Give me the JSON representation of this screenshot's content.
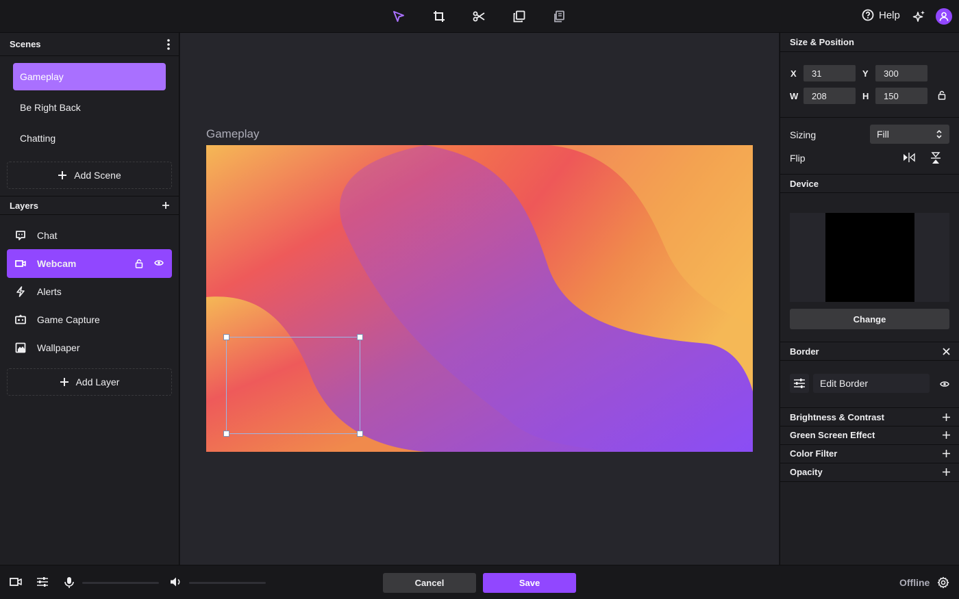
{
  "toolbar": {
    "tools": [
      "select-icon",
      "crop-icon",
      "scissors-icon",
      "duplicate-icon",
      "layers-stack-icon"
    ],
    "help_label": "Help"
  },
  "scenes": {
    "title": "Scenes",
    "items": [
      {
        "label": "Gameplay",
        "active": true
      },
      {
        "label": "Be Right Back",
        "active": false
      },
      {
        "label": "Chatting",
        "active": false
      }
    ],
    "add_label": "Add Scene"
  },
  "layers": {
    "title": "Layers",
    "items": [
      {
        "label": "Chat",
        "icon": "chat-icon",
        "active": false
      },
      {
        "label": "Webcam",
        "icon": "camera-icon",
        "active": true
      },
      {
        "label": "Alerts",
        "icon": "alert-icon",
        "active": false
      },
      {
        "label": "Game Capture",
        "icon": "gamepad-icon",
        "active": false
      },
      {
        "label": "Wallpaper",
        "icon": "image-icon",
        "active": false
      }
    ],
    "add_label": "Add Layer"
  },
  "canvas": {
    "title": "Gameplay"
  },
  "size_position": {
    "title": "Size & Position",
    "x_label": "X",
    "x": "31",
    "y_label": "Y",
    "y": "300",
    "w_label": "W",
    "w": "208",
    "h_label": "H",
    "h": "150"
  },
  "sizing": {
    "label": "Sizing",
    "value": "Fill"
  },
  "flip": {
    "label": "Flip"
  },
  "device": {
    "title": "Device",
    "change_label": "Change"
  },
  "border": {
    "title": "Border",
    "edit_label": "Edit Border"
  },
  "effects": [
    {
      "label": "Brightness & Contrast"
    },
    {
      "label": "Green Screen Effect"
    },
    {
      "label": "Color Filter"
    },
    {
      "label": "Opacity"
    }
  ],
  "bottom": {
    "cancel_label": "Cancel",
    "save_label": "Save",
    "status": "Offline"
  },
  "colors": {
    "accent": "#9147ff",
    "accent_light": "#a970ff"
  }
}
